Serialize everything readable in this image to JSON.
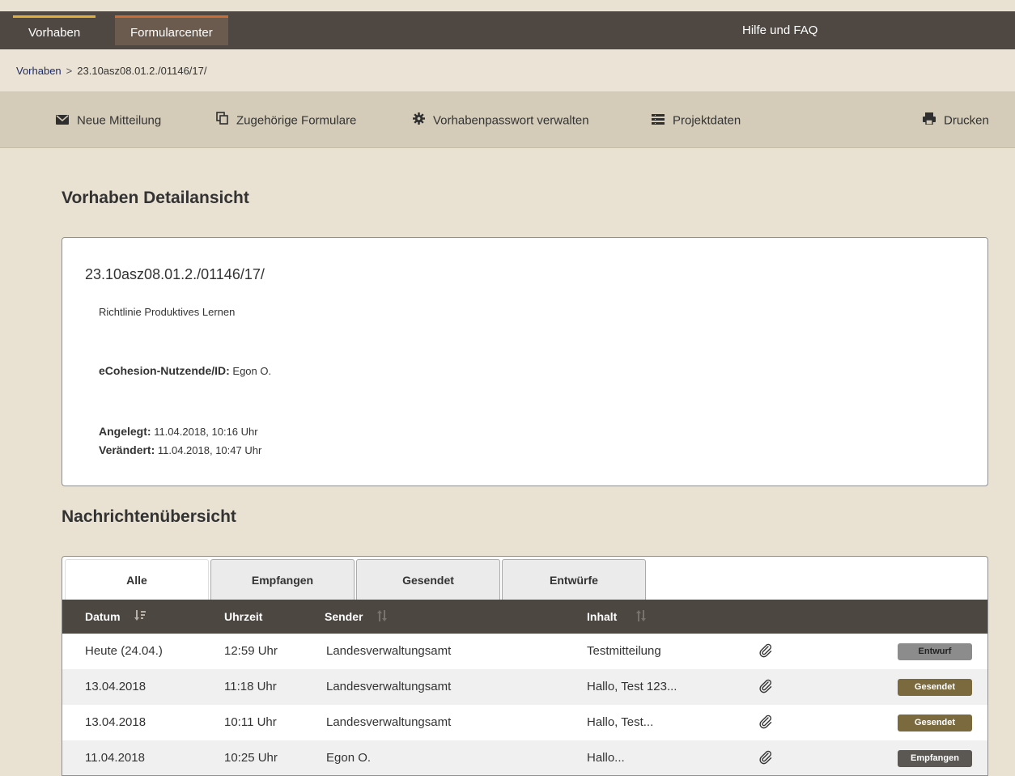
{
  "topnav": {
    "items": [
      {
        "label": "Vorhaben"
      },
      {
        "label": "Formularcenter"
      }
    ],
    "help": "Hilfe und FAQ"
  },
  "breadcrumb": {
    "root": "Vorhaben",
    "separator": ">",
    "current": "23.10asz08.01.2./01146/17/"
  },
  "toolbar": {
    "new_message": "Neue Mitteilung",
    "related_forms": "Zugehörige Formulare",
    "manage_password": "Vorhabenpasswort verwalten",
    "project_data": "Projektdaten",
    "print": "Drucken"
  },
  "page_title": "Vorhaben Detailansicht",
  "detail": {
    "project_id": "23.10asz08.01.2./01146/17/",
    "description": "Richtlinie Produktives Lernen",
    "user_label": "eCohesion-Nutzende/ID:",
    "user_value": "Egon O.",
    "created_label": "Angelegt:",
    "created_value": "11.04.2018, 10:16 Uhr",
    "modified_label": "Verändert:",
    "modified_value": "11.04.2018, 10:47 Uhr"
  },
  "messages_title": "Nachrichtenübersicht",
  "tabs": [
    {
      "label": "Alle"
    },
    {
      "label": "Empfangen"
    },
    {
      "label": "Gesendet"
    },
    {
      "label": "Entwürfe"
    }
  ],
  "table": {
    "headers": {
      "date": "Datum",
      "time": "Uhrzeit",
      "sender": "Sender",
      "content": "Inhalt"
    },
    "rows": [
      {
        "date": "Heute (24.04.)",
        "time": "12:59 Uhr",
        "sender": "Landesverwaltungsamt",
        "content": "Testmitteilung",
        "status": "Entwurf"
      },
      {
        "date": "13.04.2018",
        "time": "11:18 Uhr",
        "sender": "Landesverwaltungsamt",
        "content": "Hallo, Test 123...",
        "status": "Gesendet"
      },
      {
        "date": "13.04.2018",
        "time": "10:11 Uhr",
        "sender": "Landesverwaltungsamt",
        "content": "Hallo, Test...",
        "status": "Gesendet"
      },
      {
        "date": "11.04.2018",
        "time": "10:25 Uhr",
        "sender": "Egon O.",
        "content": "Hallo...",
        "status": "Empfangen"
      }
    ]
  },
  "colors": {
    "topbar": "#4f4842",
    "accent_yellow": "#e0b03a",
    "accent_orange": "#c86e35",
    "status_draft": "#8c8c8c",
    "status_sent": "#7c6a3f",
    "status_received": "#5b5753"
  }
}
